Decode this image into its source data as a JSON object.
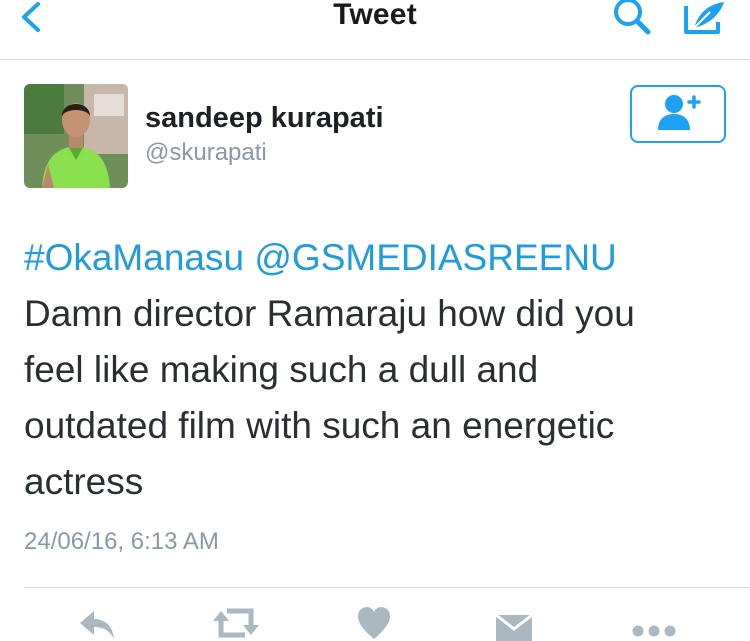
{
  "nav": {
    "title": "Tweet",
    "back_icon": "chevron-left-icon",
    "search_icon": "search-icon",
    "compose_icon": "compose-icon",
    "accent_color": "#1da1f2"
  },
  "user": {
    "name": "sandeep kurapati",
    "handle": "@skurapati",
    "follow_icon": "add-user-icon"
  },
  "tweet": {
    "hashtag": "#OkaManasu",
    "mention": "@GSMEDIASREENU",
    "text_lines": [
      "Damn director Ramaraju how did you",
      "feel like making such a dull and",
      "outdated film with such an energetic",
      "actress"
    ],
    "timestamp": "24/06/16, 6:13 AM",
    "link_color": "#1f9bde"
  },
  "actions": [
    "reply-icon",
    "retweet-icon",
    "like-icon",
    "message-icon",
    "more-icon"
  ]
}
